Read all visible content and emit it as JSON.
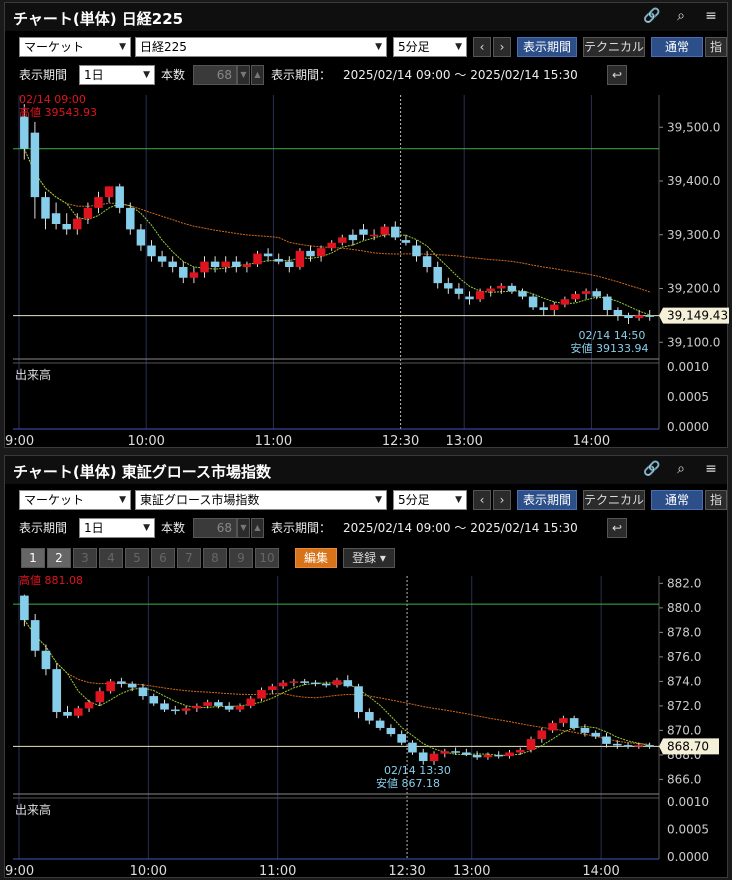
{
  "panels": [
    {
      "title": "チャート(単体) 日経225",
      "market": "マーケット",
      "symbol": "日経225",
      "interval": "5分足",
      "btn_period": "表示期間",
      "btn_technical": "テクニカル",
      "btn_normal": "通常",
      "btn_cut": "指",
      "period_label": "表示期間",
      "period_value": "1日",
      "count_label": "本数",
      "count_value": "68",
      "range_label": "表示期間：",
      "range_value": "2025/02/14 09:00 ～ 2025/02/14 15:30",
      "pages": [],
      "edit_label": "",
      "register_label": "",
      "high_time": "02/14 09:00",
      "high_text": "高値 39543.93",
      "low_time": "02/14 14:50",
      "low_text": "安値 39133.94",
      "last_price": "39,149.43",
      "volume_label": "出来高",
      "price_ticks": [
        "39,500.0",
        "39,400.0",
        "39,300.0",
        "39,200.0",
        "39,100.0"
      ],
      "vol_ticks": [
        "0.0010",
        "0.0005",
        "0.0000"
      ],
      "time_ticks": [
        "9:00",
        "10:00",
        "11:00",
        "12:30",
        "13:00",
        "14:00"
      ]
    },
    {
      "title": "チャート(単体) 東証グロース市場指数",
      "market": "マーケット",
      "symbol": "東証グロース市場指数",
      "interval": "5分足",
      "btn_period": "表示期間",
      "btn_technical": "テクニカル",
      "btn_normal": "通常",
      "btn_cut": "指",
      "period_label": "表示期間",
      "period_value": "1日",
      "count_label": "本数",
      "count_value": "68",
      "range_label": "表示期間：",
      "range_value": "2025/02/14 09:00 ～ 2025/02/14 15:30",
      "pages": [
        "1",
        "2",
        "3",
        "4",
        "5",
        "6",
        "7",
        "8",
        "9",
        "10"
      ],
      "edit_label": "編集",
      "register_label": "登録 ▾",
      "high_time": "02/14 09:00",
      "high_text": "高値 881.08",
      "low_time": "02/14 13:30",
      "low_text": "安値 867.18",
      "last_price": "868.70",
      "volume_label": "出来高",
      "price_ticks": [
        "882.0",
        "880.0",
        "878.0",
        "876.0",
        "874.0",
        "872.0",
        "870.0",
        "868.0",
        "866.0"
      ],
      "vol_ticks": [
        "0.0010",
        "0.0005",
        "0.0000"
      ],
      "time_ticks": [
        "9:00",
        "10:00",
        "11:00",
        "12:30",
        "13:00",
        "14:00"
      ]
    }
  ],
  "chart_data": [
    {
      "type": "candlestick",
      "title": "日経225",
      "ylim": [
        39080,
        39560
      ],
      "candles": [
        [
          39520,
          39543,
          39440,
          39460
        ],
        [
          39490,
          39510,
          39330,
          39370
        ],
        [
          39370,
          39380,
          39310,
          39330
        ],
        [
          39340,
          39360,
          39310,
          39320
        ],
        [
          39320,
          39340,
          39300,
          39310
        ],
        [
          39310,
          39340,
          39300,
          39330
        ],
        [
          39330,
          39360,
          39320,
          39350
        ],
        [
          39350,
          39380,
          39340,
          39370
        ],
        [
          39370,
          39390,
          39360,
          39390
        ],
        [
          39390,
          39395,
          39340,
          39350
        ],
        [
          39350,
          39360,
          39300,
          39310
        ],
        [
          39310,
          39320,
          39270,
          39280
        ],
        [
          39280,
          39290,
          39250,
          39260
        ],
        [
          39260,
          39270,
          39240,
          39250
        ],
        [
          39250,
          39260,
          39230,
          39240
        ],
        [
          39240,
          39250,
          39210,
          39220
        ],
        [
          39220,
          39240,
          39210,
          39230
        ],
        [
          39230,
          39260,
          39220,
          39250
        ],
        [
          39250,
          39260,
          39230,
          39240
        ],
        [
          39240,
          39260,
          39230,
          39250
        ],
        [
          39250,
          39260,
          39230,
          39240
        ],
        [
          39240,
          39250,
          39230,
          39245
        ],
        [
          39245,
          39270,
          39240,
          39265
        ],
        [
          39265,
          39275,
          39250,
          39260
        ],
        [
          39255,
          39265,
          39245,
          39250
        ],
        [
          39250,
          39260,
          39230,
          39240
        ],
        [
          39240,
          39275,
          39235,
          39270
        ],
        [
          39270,
          39280,
          39250,
          39260
        ],
        [
          39260,
          39280,
          39250,
          39275
        ],
        [
          39275,
          39290,
          39270,
          39285
        ],
        [
          39285,
          39300,
          39280,
          39295
        ],
        [
          39300,
          39310,
          39280,
          39290
        ],
        [
          39310,
          39320,
          39290,
          39300
        ],
        [
          39300,
          39310,
          39290,
          39300
        ],
        [
          39300,
          39320,
          39295,
          39315
        ],
        [
          39315,
          39325,
          39290,
          39295
        ],
        [
          39290,
          39300,
          39280,
          39285
        ],
        [
          39280,
          39290,
          39250,
          39260
        ],
        [
          39260,
          39270,
          39230,
          39240
        ],
        [
          39240,
          39250,
          39200,
          39210
        ],
        [
          39210,
          39220,
          39190,
          39200
        ],
        [
          39200,
          39210,
          39180,
          39190
        ],
        [
          39185,
          39195,
          39170,
          39180
        ],
        [
          39180,
          39200,
          39175,
          39195
        ],
        [
          39195,
          39205,
          39185,
          39200
        ],
        [
          39200,
          39210,
          39190,
          39205
        ],
        [
          39205,
          39210,
          39190,
          39195
        ],
        [
          39195,
          39200,
          39180,
          39185
        ],
        [
          39185,
          39190,
          39160,
          39165
        ],
        [
          39165,
          39175,
          39150,
          39160
        ],
        [
          39160,
          39175,
          39150,
          39170
        ],
        [
          39170,
          39185,
          39165,
          39180
        ],
        [
          39180,
          39195,
          39175,
          39190
        ],
        [
          39190,
          39200,
          39180,
          39195
        ],
        [
          39195,
          39200,
          39180,
          39185
        ],
        [
          39185,
          39190,
          39150,
          39160
        ],
        [
          39160,
          39165,
          39140,
          39150
        ],
        [
          39150,
          39155,
          39134,
          39145
        ],
        [
          39145,
          39160,
          39140,
          39150
        ],
        [
          39150,
          39160,
          39140,
          39149
        ]
      ],
      "hline_green": 39460,
      "hline_last": 39149.43
    },
    {
      "type": "candlestick",
      "title": "東証グロース市場指数",
      "ylim": [
        865.3,
        882.6
      ],
      "candles": [
        [
          881.0,
          881.08,
          878.5,
          879.0
        ],
        [
          879.0,
          879.5,
          876.0,
          876.5
        ],
        [
          876.5,
          877.0,
          874.5,
          875.0
        ],
        [
          875.0,
          875.5,
          871.0,
          871.5
        ],
        [
          871.5,
          872.0,
          871.0,
          871.2
        ],
        [
          871.2,
          872.0,
          871.0,
          871.8
        ],
        [
          871.8,
          872.5,
          871.5,
          872.3
        ],
        [
          872.3,
          873.5,
          872.0,
          873.2
        ],
        [
          873.2,
          874.2,
          873.0,
          874.0
        ],
        [
          874.0,
          874.3,
          873.5,
          873.8
        ],
        [
          873.8,
          874.0,
          873.2,
          873.5
        ],
        [
          873.5,
          873.8,
          872.5,
          872.8
        ],
        [
          872.8,
          873.0,
          872.0,
          872.2
        ],
        [
          872.2,
          872.5,
          871.5,
          871.7
        ],
        [
          871.7,
          872.0,
          871.3,
          871.6
        ],
        [
          871.6,
          872.0,
          871.3,
          871.8
        ],
        [
          871.8,
          872.2,
          871.5,
          872.0
        ],
        [
          872.0,
          872.5,
          871.8,
          872.3
        ],
        [
          872.3,
          872.5,
          871.8,
          872.0
        ],
        [
          872.0,
          872.3,
          871.5,
          871.7
        ],
        [
          871.7,
          872.2,
          871.5,
          872.0
        ],
        [
          872.0,
          872.8,
          871.8,
          872.6
        ],
        [
          872.6,
          873.5,
          872.4,
          873.3
        ],
        [
          873.3,
          873.8,
          873.0,
          873.6
        ],
        [
          873.6,
          874.1,
          873.4,
          873.9
        ],
        [
          873.9,
          874.2,
          873.6,
          874.0
        ],
        [
          874.0,
          874.2,
          873.7,
          873.9
        ],
        [
          873.9,
          874.1,
          873.6,
          873.8
        ],
        [
          873.8,
          874.0,
          873.5,
          873.7
        ],
        [
          873.7,
          874.3,
          873.5,
          874.1
        ],
        [
          874.1,
          874.5,
          873.5,
          873.6
        ],
        [
          873.6,
          873.8,
          871.0,
          871.5
        ],
        [
          871.5,
          871.8,
          870.5,
          870.8
        ],
        [
          870.8,
          871.0,
          870.0,
          870.2
        ],
        [
          870.2,
          870.5,
          869.5,
          869.7
        ],
        [
          869.7,
          870.0,
          868.8,
          869.0
        ],
        [
          869.0,
          869.2,
          868.0,
          868.2
        ],
        [
          868.2,
          868.5,
          867.2,
          867.5
        ],
        [
          867.5,
          868.3,
          867.18,
          868.1
        ],
        [
          868.1,
          868.5,
          867.8,
          868.3
        ],
        [
          868.3,
          868.6,
          868.0,
          868.2
        ],
        [
          868.2,
          868.5,
          867.9,
          868.0
        ],
        [
          868.0,
          868.3,
          867.6,
          867.8
        ],
        [
          867.8,
          868.2,
          867.6,
          868.0
        ],
        [
          868.0,
          868.3,
          867.7,
          867.9
        ],
        [
          867.9,
          868.4,
          867.7,
          868.2
        ],
        [
          868.2,
          868.6,
          868.0,
          868.4
        ],
        [
          868.4,
          869.5,
          868.2,
          869.3
        ],
        [
          869.3,
          870.2,
          869.0,
          870.0
        ],
        [
          870.0,
          870.8,
          869.8,
          870.6
        ],
        [
          870.6,
          871.2,
          870.3,
          871.0
        ],
        [
          871.0,
          871.2,
          870.0,
          870.2
        ],
        [
          870.2,
          870.5,
          869.5,
          869.8
        ],
        [
          869.8,
          870.0,
          869.3,
          869.5
        ],
        [
          869.5,
          869.8,
          868.6,
          868.9
        ],
        [
          868.9,
          869.2,
          868.5,
          868.8
        ],
        [
          868.8,
          869.0,
          868.5,
          868.7
        ],
        [
          868.7,
          869.0,
          868.5,
          868.8
        ],
        [
          868.8,
          869.0,
          868.5,
          868.7
        ]
      ],
      "hline_green": 880.3,
      "hline_last": 868.7
    }
  ],
  "colors": {
    "up": "#e0141e",
    "down": "#87ceeb",
    "ma_short": "#9acd32",
    "ma_long": "#d2691e",
    "green_line": "#3cb043",
    "grid": "#2a2f55"
  }
}
